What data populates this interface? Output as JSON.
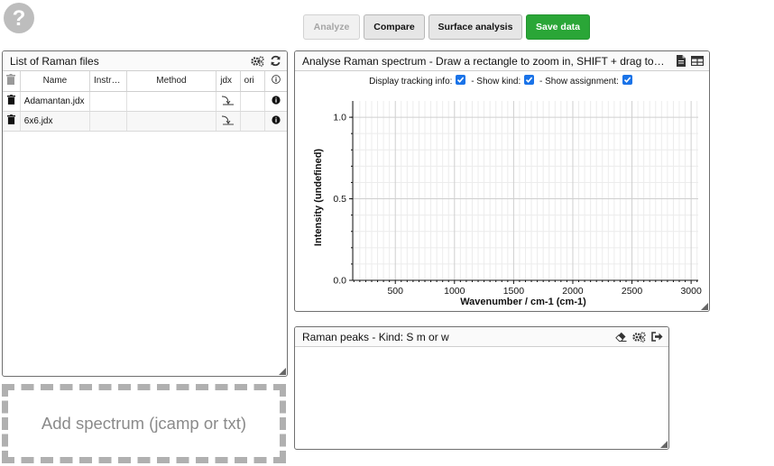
{
  "toolbar": {
    "analyze_label": "Analyze",
    "compare_label": "Compare",
    "surface_label": "Surface analysis",
    "save_label": "Save data"
  },
  "files_panel": {
    "title": "List of Raman files",
    "columns": [
      "Name",
      "Instr…",
      "Method",
      "jdx",
      "ori"
    ],
    "rows": [
      {
        "name": "Adamantan.jdx",
        "instrument": "",
        "method": ""
      },
      {
        "name": "6x6.jdx",
        "instrument": "",
        "method": ""
      }
    ]
  },
  "spectrum_panel": {
    "title": "Analyse Raman spectrum - Draw a rectangle to zoom in, SHIFT + drag to…",
    "options": {
      "tracking_label": "Display tracking info:",
      "kind_label": "- Show kind:",
      "assignment_label": "- Show assignment:"
    }
  },
  "chart_data": {
    "type": "line",
    "series": [],
    "xlabel": "Wavenumber / cm-1  (cm-1)",
    "ylabel": "Intensity  (undefined)",
    "xlim": [
      140,
      3060
    ],
    "ylim": [
      0,
      1.1
    ],
    "xticks": [
      500,
      1000,
      1500,
      2000,
      2500,
      3000
    ],
    "yticks": [
      0.0,
      0.5,
      1.0
    ],
    "xtick_labels": [
      "500",
      "1000",
      "1500",
      "2000",
      "2500",
      "3000"
    ],
    "ytick_labels": [
      "0.0",
      "0.5",
      "1.0"
    ],
    "grid": true
  },
  "peaks_panel": {
    "title": "Raman peaks - Kind: S m or w"
  },
  "dropzone": {
    "label": "Add spectrum (jcamp or txt)"
  },
  "colors": {
    "save_button": "#2aa637",
    "checkbox": "#1a73e8",
    "grid_major": "#cfcfcf",
    "grid_minor": "#ececec"
  }
}
